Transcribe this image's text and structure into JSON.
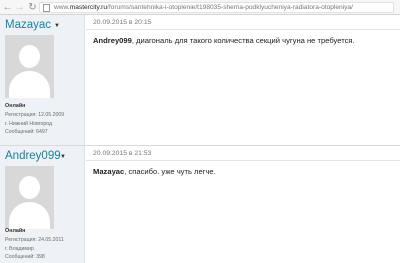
{
  "browser": {
    "url_prefix": "www.",
    "url_host": "mastercity.ru",
    "url_path": "/forums/santehnika-i-otoplenie/t198035-shema-podklyucheniya-radiatora-otopleniya/"
  },
  "posts": [
    {
      "username": "Mazayac",
      "status": "Онлайн",
      "registered": "Регистрация: 12.05.2009",
      "city": "г. Нижний Новгород",
      "messages": "Сообщений: 6497",
      "date": "20.09.2015 в 20:15",
      "mention": "Andrey099",
      "text": ", диагональ для такого количества секций чугуна не требуется."
    },
    {
      "username": "Andrey099",
      "status": "Онлайн",
      "registered": "Регистрация: 24.05.2011",
      "city": "г. Владимир",
      "messages": "Сообщений: 398",
      "date": "20.09.2015 в 21:53",
      "mention": "Mazayac",
      "text": ", спасибо. уже чуть легче."
    }
  ],
  "colors": {
    "username": "#1a7f9e",
    "sidebar_bg": "#eef2f6"
  },
  "icons": {
    "back": "arrow-left-icon",
    "forward": "arrow-right-icon",
    "reload": "reload-icon",
    "page": "page-icon",
    "caret": "caret-down-icon",
    "avatar": "default-avatar-icon"
  }
}
